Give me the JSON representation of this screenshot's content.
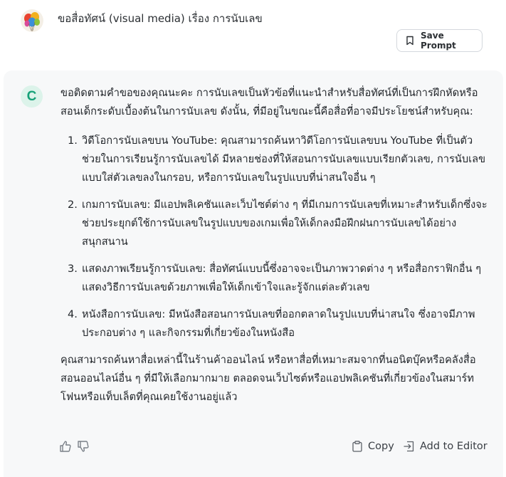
{
  "prompt": {
    "text": "ขอสื่อทัศน์ (visual media) เรื่อง การนับเลข",
    "save_label": "Save Prompt"
  },
  "response": {
    "bot_initial": "C",
    "intro": "ขอติดตามคำขอของคุณนะคะ การนับเลขเป็นหัวข้อที่แนะนำสำหรับสื่อทัศน์ที่เป็นการฝึกหัดหรือสอนเด็กระดับเบื้องต้นในการนับเลข ดังนั้น, ที่มีอยู่ในขณะนี้คือสื่อที่อาจมีประโยชน์สำหรับคุณ:",
    "items": [
      {
        "num": "1.",
        "text": "วิดีโอการนับเลขบน YouTube: คุณสามารถค้นหาวิดีโอการนับเลขบน YouTube ที่เป็นตัวช่วยในการเรียนรู้การนับเลขได้ มีหลายช่องที่ให้สอนการนับเลขแบบเรียกตัวเลข, การนับเลขแบบใส่ตัวเลขลงในกรอบ, หรือการนับเลขในรูปแบบที่น่าสนใจอื่น ๆ"
      },
      {
        "num": "2.",
        "text": "เกมการนับเลข: มีแอปพลิเคชันและเว็บไซต์ต่าง ๆ ที่มีเกมการนับเลขที่เหมาะสำหรับเด็กซึ่งจะช่วยประยุกต์ใช้การนับเลขในรูปแบบของเกมเพื่อให้เด็กลงมือฝึกฝนการนับเลขได้อย่างสนุกสนาน"
      },
      {
        "num": "3.",
        "text": "แสดงภาพเรียนรู้การนับเลข: สื่อทัศน์แบบนี้ซึ่งอาจจะเป็นภาพวาดต่าง ๆ หรือสื่อกราฟิกอื่น ๆ แสดงวิธีการนับเลขด้วยภาพเพื่อให้เด็กเข้าใจและรู้จักแต่ละตัวเลข"
      },
      {
        "num": "4.",
        "text": "หนังสือการนับเลข: มีหนังสือสอนการนับเลขที่ออกตลาดในรูปแบบที่น่าสนใจ ซึ่งอาจมีภาพประกอบต่าง ๆ และกิจกรรมที่เกี่ยวข้องในหนังสือ"
      }
    ],
    "outro": "คุณสามารถค้นหาสื่อเหล่านี้ในร้านค้าออนไลน์ หรือหาสื่อที่เหมาะสมจากที่นอนิตบุ๊คหรือคลังสื่อสอนออนไลน์อื่น ๆ ที่มีให้เลือกมากมาย ตลอดจนเว็บไซต์หรือแอปพลิเคชันที่เกี่ยวข้องในสมาร์ทโฟนหรือแท็บเล็ตที่คุณเคยใช้งานอยู่แล้ว"
  },
  "actions": {
    "copy_label": "Copy",
    "editor_label": "Add to Editor"
  },
  "colors": {
    "accent": "#16a178",
    "panel_bg": "#f7f8f9",
    "bot_avatar_bg": "#dcf3ea"
  }
}
